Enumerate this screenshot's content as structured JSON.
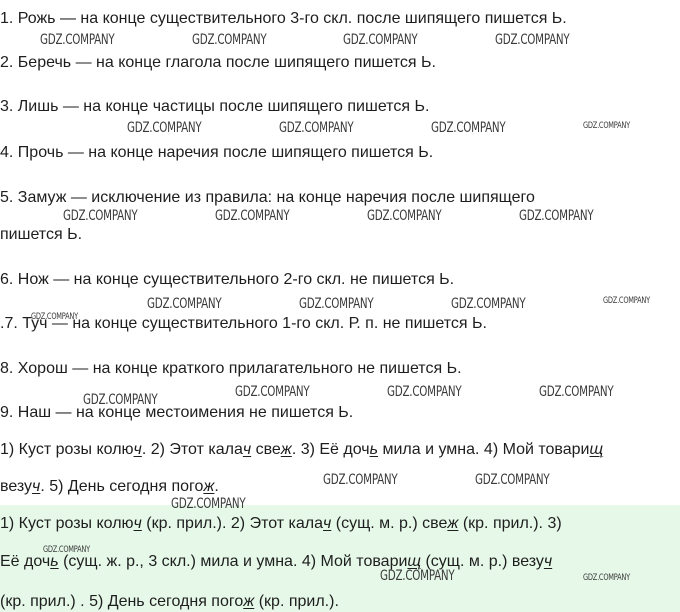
{
  "items": [
    "1. Рожь — на конце существительного 3-го скл. после шипящего пишется Ь.",
    "2. Беречь — на конце глагола после шипящего пишется Ь.",
    "3. Лишь — на конце частицы после шипящего пишется Ь.",
    "4. Прочь — на конце наречия после шипящего пишется Ь.",
    "5. Замуж — исключение из правила: на конце наречия после шипящего",
    "пишется Ь.",
    "6. Нож — на конце существительного 2-го скл. не пишется Ь.",
    "7. Туч — на конце существительного 1-го скл. Р. п. не пишется Ь.",
    "8. Хорош — на конце краткого прилагательного не пишется Ь.",
    "9. Наш — на конце местоимения не пишется Ь."
  ],
  "sentences": {
    "l1": [
      "1) Куст розы колю",
      "ч",
      ". 2) Этот кала",
      "ч",
      " све",
      "ж",
      ". 3) Её доч",
      "ь",
      " мила и умна. 4) Мой товари",
      "щ"
    ],
    "l2": [
      "везу",
      "ч",
      ". 5) День сегодня пого",
      "ж",
      "."
    ]
  },
  "answers": {
    "l1": [
      "1) Куст розы колю",
      "ч",
      " (кр. прил.). 2) Этот кала",
      "ч",
      " (сущ. м. р.) све",
      "ж",
      " (кр. прил.). 3)"
    ],
    "l2": [
      "Её доч",
      "ь",
      " (сущ. ж. р., 3 скл.) мила и умна. 4) Мой товари",
      "щ",
      " (сущ. м. р.) везу",
      "ч"
    ],
    "l3": [
      "(кр. прил.) . 5) День сегодня пого",
      "ж",
      " (кр. прил.)."
    ]
  },
  "watermark": "GDZ.COMPANY",
  "colors": {
    "answer_bg": "#e6f9e9",
    "text": "#1e1e1e"
  }
}
